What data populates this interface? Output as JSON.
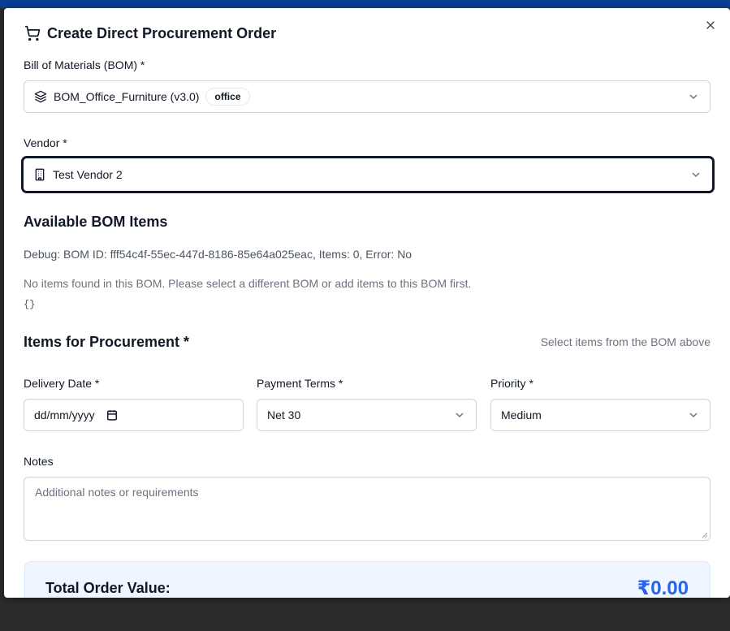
{
  "dialog": {
    "title": "Create Direct Procurement Order",
    "icons": {
      "cart": "cart-icon",
      "close": "close-icon"
    }
  },
  "bom": {
    "label": "Bill of Materials (BOM) *",
    "selected": "BOM_Office_Furniture (v3.0)",
    "badge": "office",
    "icon": "layers-icon"
  },
  "vendor": {
    "label": "Vendor *",
    "selected": "Test Vendor 2",
    "icon": "building-icon"
  },
  "available": {
    "heading": "Available BOM Items",
    "debug": "Debug: BOM ID: fff54c4f-55ec-447d-8186-85e64a025eac, Items: 0, Error: No",
    "empty": "No items found in this BOM. Please select a different BOM or add items to this BOM first.",
    "json": "{}"
  },
  "procurement": {
    "heading": "Items for Procurement *",
    "hint": "Select items from the BOM above"
  },
  "delivery": {
    "label": "Delivery Date *",
    "placeholder": "dd/mm/yyyy"
  },
  "payment": {
    "label": "Payment Terms *",
    "selected": "Net 30"
  },
  "priority": {
    "label": "Priority *",
    "selected": "Medium"
  },
  "notes": {
    "label": "Notes",
    "placeholder": "Additional notes or requirements"
  },
  "total": {
    "label": "Total Order Value:",
    "value": "₹0.00"
  },
  "colors": {
    "accent": "#2563eb",
    "topbar": "#0b3d91",
    "total_bg": "#eff6ff"
  }
}
